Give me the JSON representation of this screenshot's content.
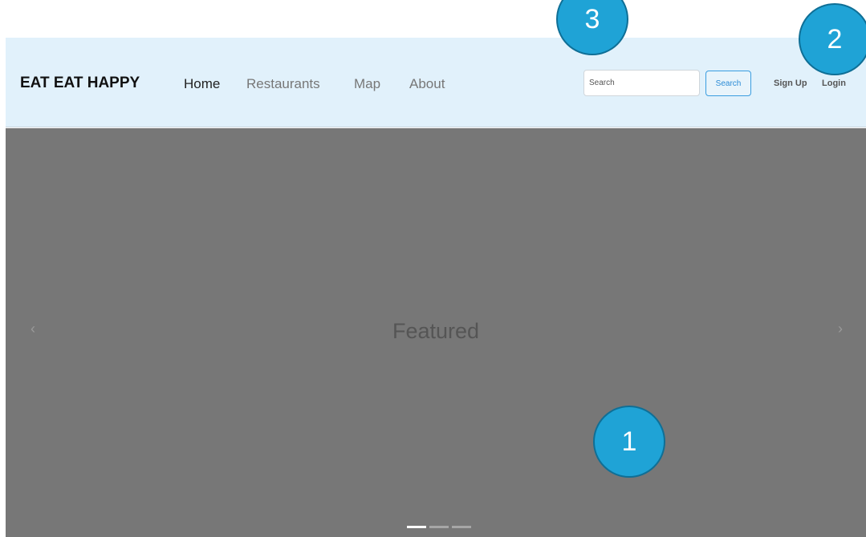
{
  "navbar": {
    "brand": "EAT EAT HAPPY",
    "links": [
      {
        "label": "Home",
        "active": true
      },
      {
        "label": "Restaurants",
        "active": false
      },
      {
        "label": "Map",
        "active": false
      },
      {
        "label": "About",
        "active": false
      }
    ],
    "search": {
      "placeholder": "Search",
      "value": "",
      "button_label": "Search"
    },
    "auth": {
      "signup_label": "Sign Up",
      "login_label": "Login"
    }
  },
  "hero": {
    "text": "Featured",
    "prev_arrow": "‹",
    "next_arrow": "›",
    "indicator_count": 3,
    "active_indicator": 0
  },
  "annotations": {
    "callout_1": "1",
    "callout_2": "2",
    "callout_3": "3"
  },
  "colors": {
    "navbar_bg": "#e1f1fb",
    "hero_bg": "#777777",
    "callout_fill": "#1fa3d6",
    "accent": "#2b8bd6"
  }
}
